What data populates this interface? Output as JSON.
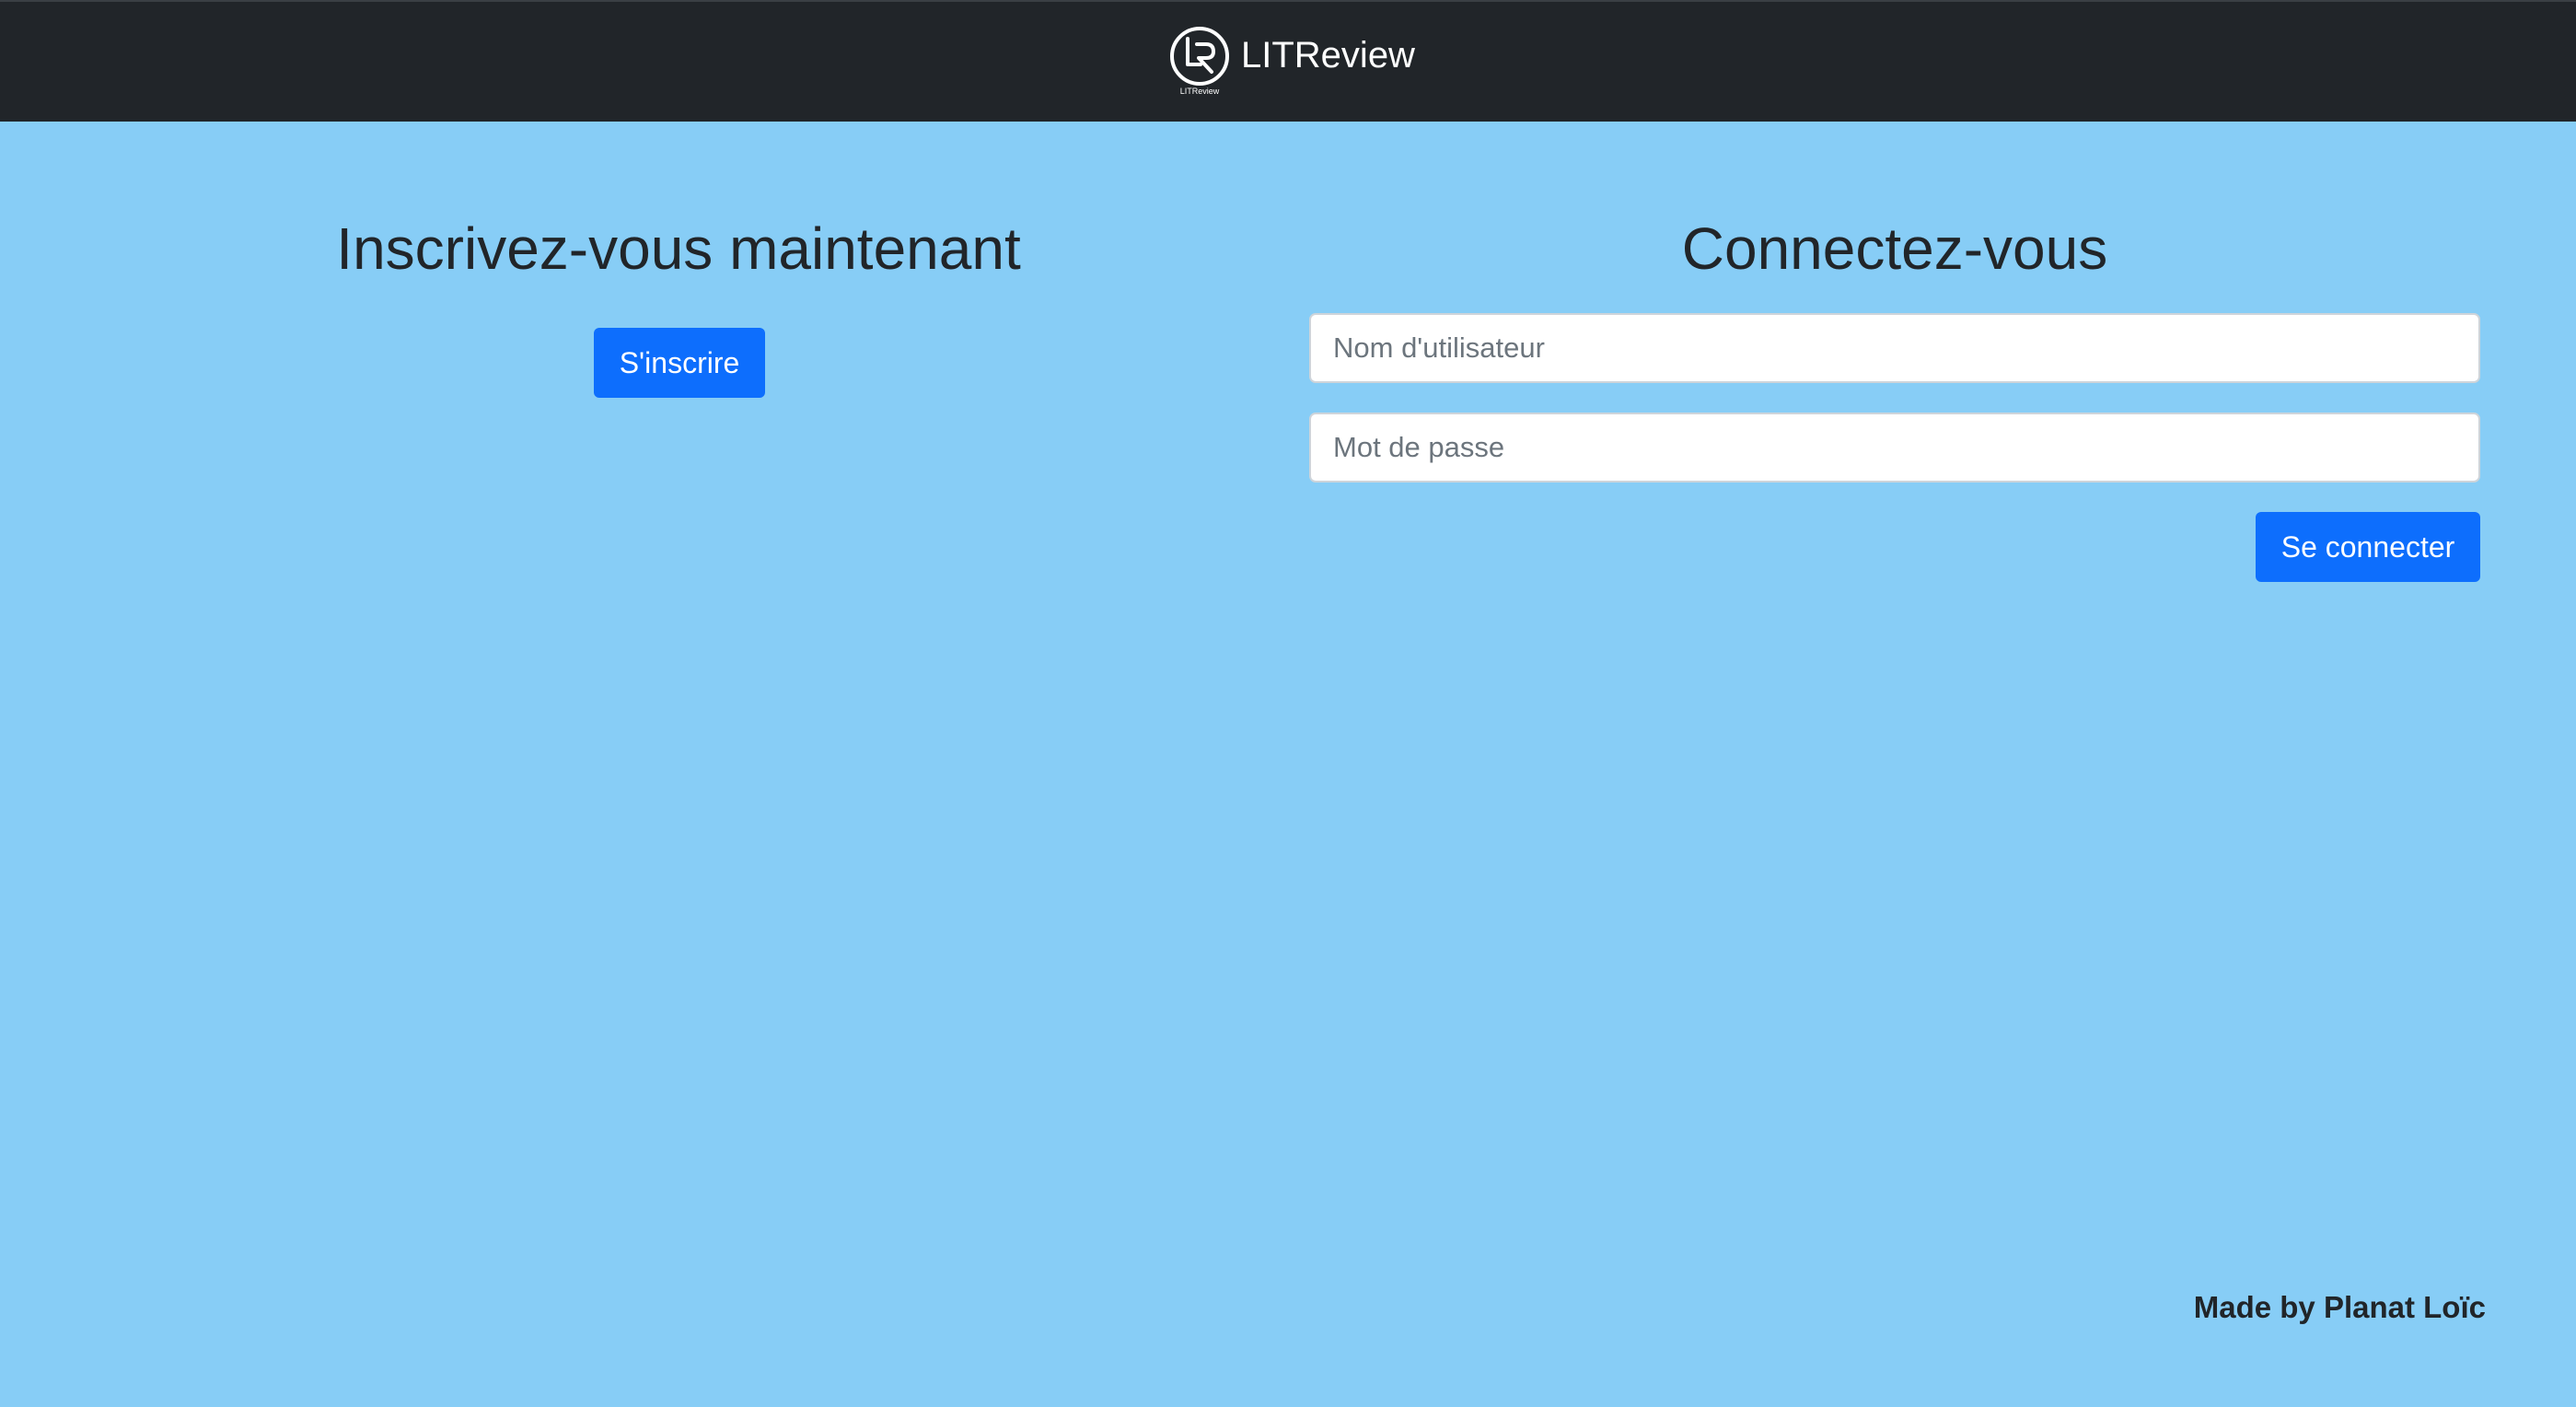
{
  "app": {
    "name": "LITReview",
    "logo_caption": "LITReview"
  },
  "signup": {
    "title": "Inscrivez-vous maintenant",
    "button_label": "S'inscrire"
  },
  "login": {
    "title": "Connectez-vous",
    "username_placeholder": "Nom d'utilisateur",
    "password_placeholder": "Mot de passe",
    "button_label": "Se connecter"
  },
  "footer": {
    "text": "Made by Planat Loïc"
  },
  "colors": {
    "navbar": "#212529",
    "background": "#87cdf6",
    "primary": "#0d6efd"
  },
  "icons": {
    "logo": "litreview-logo-icon"
  }
}
